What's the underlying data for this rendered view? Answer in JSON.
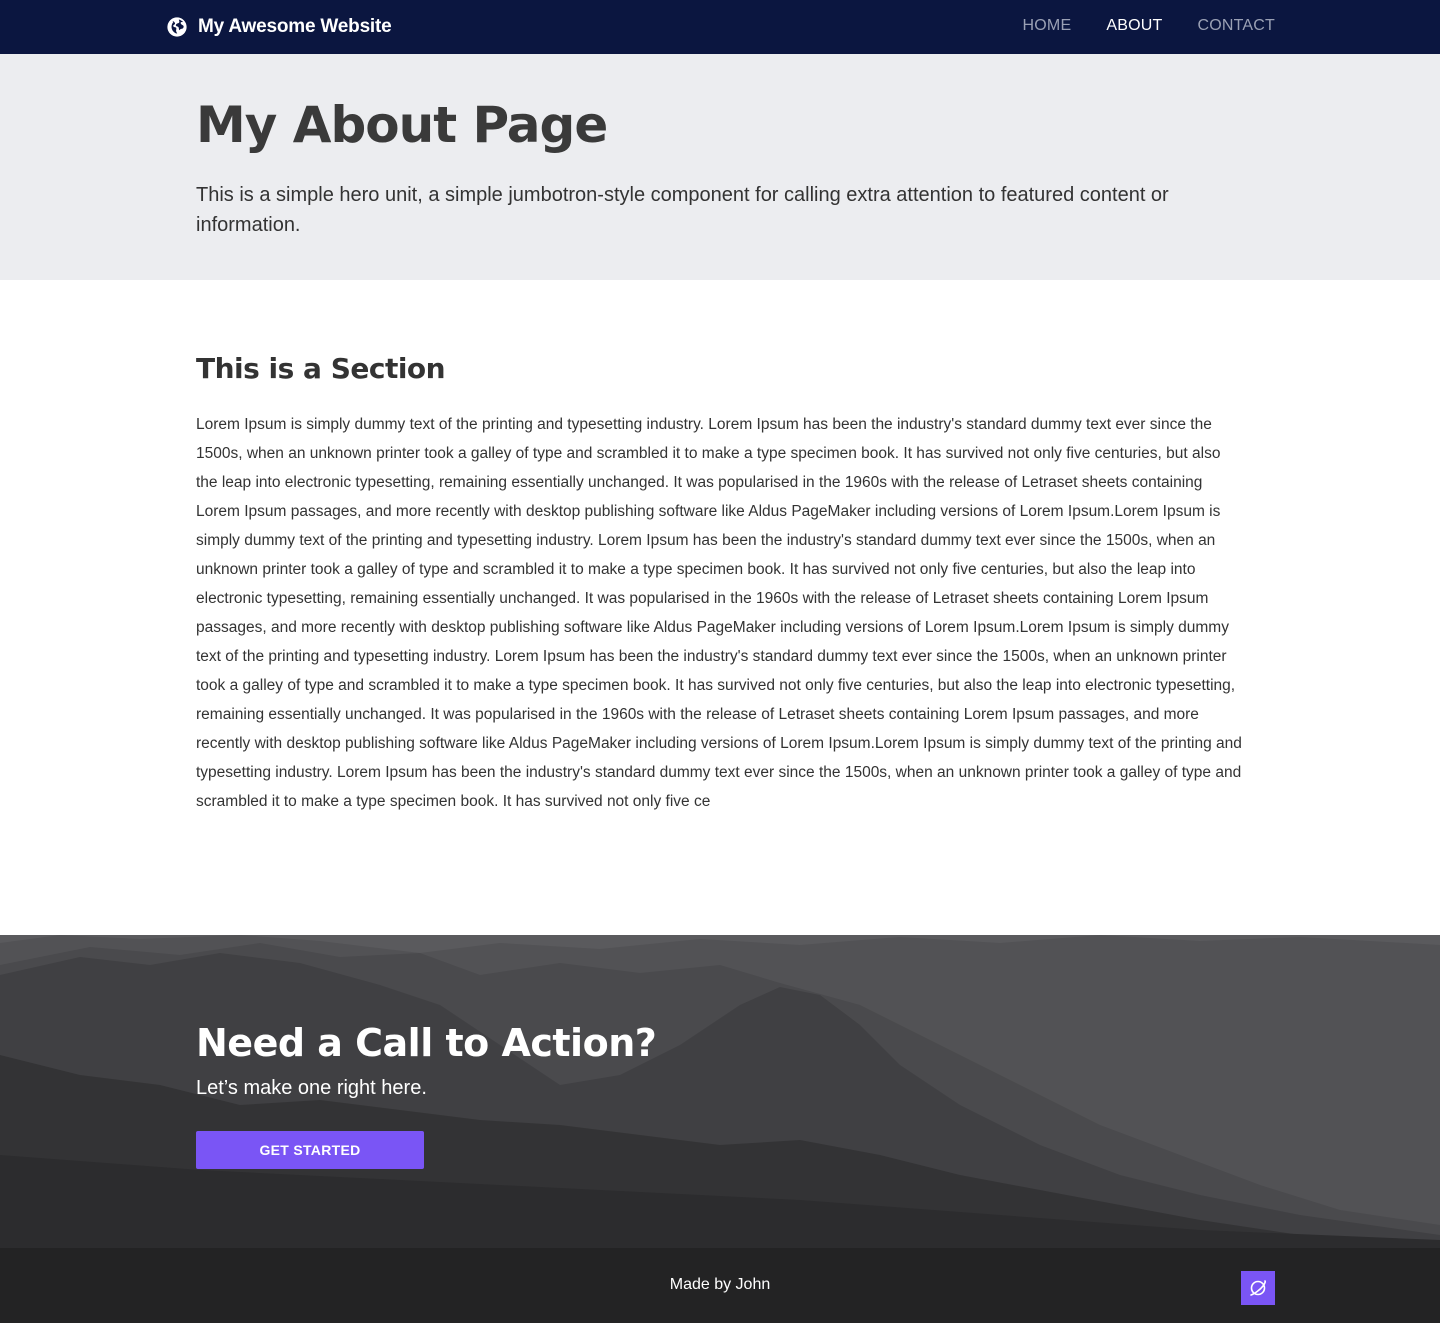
{
  "navbar": {
    "brand_icon": "globe-icon",
    "brand": "My Awesome Website",
    "links": [
      {
        "label": "HOME",
        "active": false
      },
      {
        "label": "ABOUT",
        "active": true
      },
      {
        "label": "CONTACT",
        "active": false
      }
    ]
  },
  "hero": {
    "title": "My About Page",
    "lead": "This is a simple hero unit, a simple jumbotron-style component for calling extra attention to featured content or information."
  },
  "section": {
    "title": "This is a Section",
    "body": "Lorem Ipsum is simply dummy text of the printing and typesetting industry. Lorem Ipsum has been the industry's standard dummy text ever since the 1500s, when an unknown printer took a galley of type and scrambled it to make a type specimen book. It has survived not only five centuries, but also the leap into electronic typesetting, remaining essentially unchanged. It was popularised in the 1960s with the release of Letraset sheets containing Lorem Ipsum passages, and more recently with desktop publishing software like Aldus PageMaker including versions of Lorem Ipsum.Lorem Ipsum is simply dummy text of the printing and typesetting industry. Lorem Ipsum has been the industry's standard dummy text ever since the 1500s, when an unknown printer took a galley of type and scrambled it to make a type specimen book. It has survived not only five centuries, but also the leap into electronic typesetting, remaining essentially unchanged. It was popularised in the 1960s with the release of Letraset sheets containing Lorem Ipsum passages, and more recently with desktop publishing software like Aldus PageMaker including versions of Lorem Ipsum.Lorem Ipsum is simply dummy text of the printing and typesetting industry. Lorem Ipsum has been the industry's standard dummy text ever since the 1500s, when an unknown printer took a galley of type and scrambled it to make a type specimen book. It has survived not only five centuries, but also the leap into electronic typesetting, remaining essentially unchanged. It was popularised in the 1960s with the release of Letraset sheets containing Lorem Ipsum passages, and more recently with desktop publishing software like Aldus PageMaker including versions of Lorem Ipsum.Lorem Ipsum is simply dummy text of the printing and typesetting industry. Lorem Ipsum has been the industry's standard dummy text ever since the 1500s, when an unknown printer took a galley of type and scrambled it to make a type specimen book. It has survived not only five ce"
  },
  "cta": {
    "title": "Need a Call to Action?",
    "subtitle": "Let’s make one right here.",
    "button_label": "GET STARTED"
  },
  "footer": {
    "text": "Made by John",
    "icon": "planet-icon"
  },
  "colors": {
    "navbar_bg": "#0b1640",
    "accent": "#7a55f5",
    "hero_bg": "#ecedf0",
    "footer_bg": "#232324"
  }
}
